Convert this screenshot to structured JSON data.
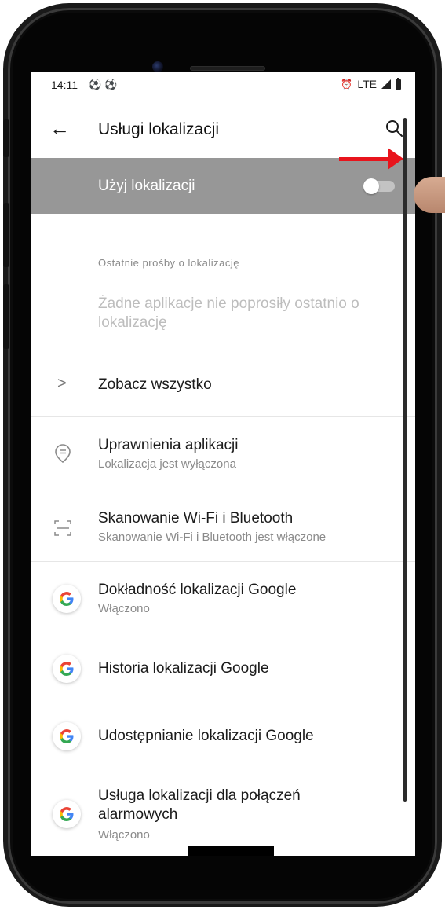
{
  "status_bar": {
    "time": "14:11",
    "icons_left": [
      "soccer-ball",
      "soccer-ball"
    ],
    "ball_glyph": "⚽",
    "network": "LTE",
    "alarm_glyph": "⏰",
    "icons_right": [
      "alarm",
      "lte",
      "signal",
      "battery"
    ]
  },
  "app_bar": {
    "back_glyph": "←",
    "title": "Usługi lokalizacji",
    "search_icon": "search-icon"
  },
  "master_switch": {
    "label": "Użyj lokalizacji",
    "state": "off"
  },
  "recent_requests": {
    "header": "Ostatnie prośby o lokalizację",
    "empty_text": "Żadne aplikacje nie poprosiły ostatnio o lokalizację"
  },
  "see_all": {
    "chevron": ">",
    "label": "Zobacz wszystko"
  },
  "settings": {
    "app_permissions": {
      "title": "Uprawnienia aplikacji",
      "subtitle": "Lokalizacja jest wyłączona"
    },
    "scanning": {
      "title": "Skanowanie Wi-Fi i Bluetooth",
      "subtitle": "Skanowanie Wi-Fi i Bluetooth jest włączone"
    }
  },
  "google": {
    "accuracy": {
      "title": "Dokładność lokalizacji Google",
      "subtitle": "Włączono"
    },
    "history": {
      "title": "Historia lokalizacji Google"
    },
    "sharing": {
      "title": "Udostępnianie lokalizacji Google"
    },
    "emergency": {
      "title_line1": "Usługa lokalizacji dla połączeń",
      "title_line2": "alarmowych",
      "subtitle": "Włączono"
    }
  },
  "colors": {
    "highlight_row": "#979797",
    "pointer_arrow": "#e8141c",
    "google_blue": "#4285F4",
    "google_red": "#EA4335",
    "google_yellow": "#FBBC05",
    "google_green": "#34A853"
  }
}
